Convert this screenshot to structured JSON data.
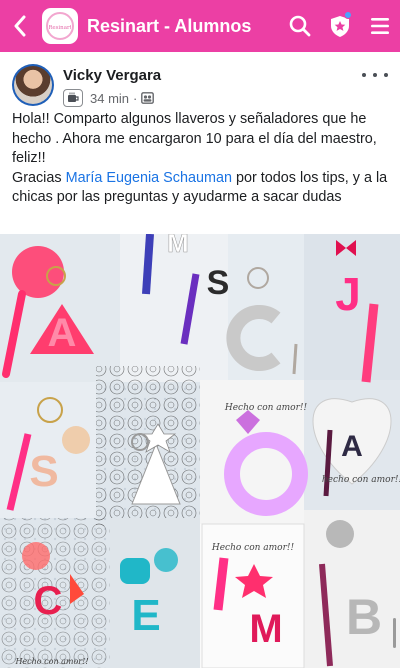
{
  "topbar": {
    "title": "Resinart - Alumnos",
    "logo_text": "Resinart",
    "back_icon": "chevron-left-icon",
    "search_icon": "search-icon",
    "shield_icon": "star-shield-icon",
    "menu_icon": "hamburger-menu-icon",
    "accent_color": "#ec3fa4"
  },
  "post": {
    "author": "Vicky Vergara",
    "time": "34 min",
    "separator": "·",
    "text_lines": [
      "Hola!! Comparto algunos llaveros y señaladores que he hecho . Ahora me encargaron 10 para el día del maestro, feliz!!"
    ],
    "thanks_prefix": "Gracias ",
    "mention": "María Eugenia Schauman",
    "thanks_suffix": " por todos los tips, y a la chicas por las preguntas y ayudarme a sacar dudas",
    "mention_color": "#1b74e4"
  },
  "photo": {
    "tiles": [
      {
        "letter": "A",
        "color": "#ff3d6e"
      },
      {
        "letter": "M",
        "color": "#ffffff"
      },
      {
        "letter": "S",
        "color": "#2b2b2b"
      },
      {
        "letter": "J",
        "color": "#ff2f86"
      },
      {
        "letter": "C",
        "color": "#c9c9c9"
      },
      {
        "letter": "S",
        "color": "#f0b9a0"
      },
      {
        "letter": "A",
        "color": "#ffffff"
      },
      {
        "letter": "O",
        "color": "#e7a7ff"
      },
      {
        "letter": "A",
        "color": "#2e2a44"
      },
      {
        "letter": "C",
        "color": "#e81f4f"
      },
      {
        "letter": "E",
        "color": "#20b7c8"
      },
      {
        "letter": "M",
        "color": "#e01a5a"
      },
      {
        "letter": "B",
        "color": "#b7b7b7"
      }
    ],
    "captions": [
      "Hecho con amor!!",
      "Hecho con amor!!",
      "hecho con amor!!",
      "Hecho con amor!!"
    ]
  }
}
